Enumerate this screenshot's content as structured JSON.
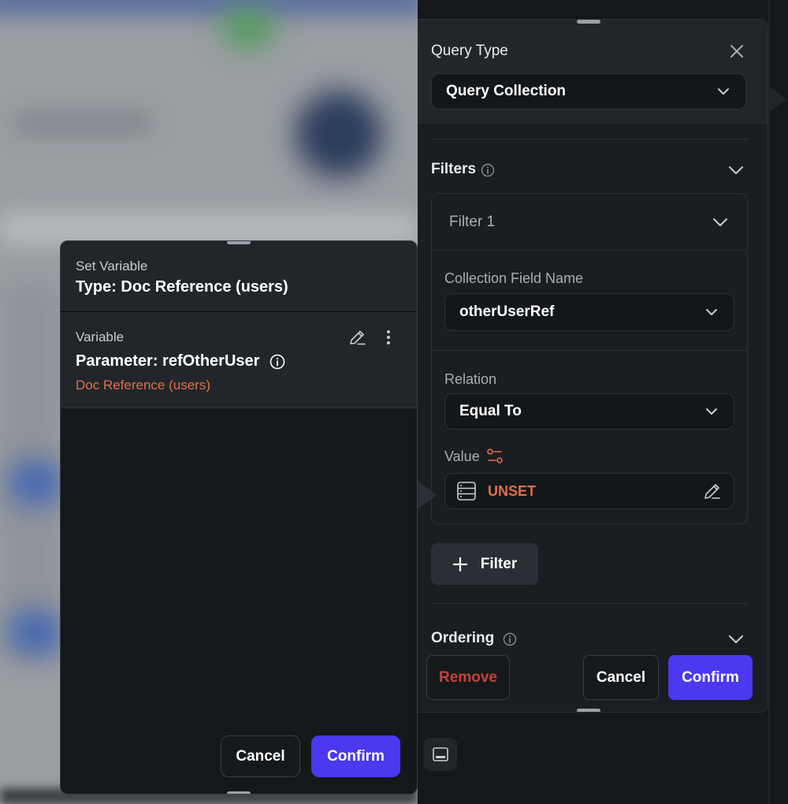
{
  "set_variable": {
    "header_label": "Set Variable",
    "type_label": "Type: Doc Reference (users)",
    "variable_label": "Variable",
    "parameter": "Parameter: refOtherUser",
    "doc_type": "Doc Reference (users)",
    "cancel_label": "Cancel",
    "confirm_label": "Confirm"
  },
  "query": {
    "query_type_label": "Query Type",
    "query_type_value": "Query Collection",
    "filters_label": "Filters",
    "filter_name": "Filter 1",
    "collection_field_label": "Collection Field Name",
    "collection_field_value": "otherUserRef",
    "relation_label": "Relation",
    "relation_value": "Equal To",
    "value_label": "Value",
    "value_status": "UNSET",
    "add_filter_label": "Filter",
    "ordering_label": "Ordering",
    "remove_label": "Remove",
    "cancel_label": "Cancel",
    "confirm_label": "Confirm"
  },
  "colors": {
    "accent": "#4b39ef",
    "warning_orange": "#e2704a",
    "remove_red": "#c8403a",
    "panel_bg": "#1a1d21",
    "surface_bg": "#22262b"
  },
  "icons": [
    "close-icon",
    "chevron-down-icon",
    "info-icon",
    "edit-icon",
    "more-vertical-icon",
    "database-icon",
    "variable-icon",
    "plus-icon",
    "panel-toggle-icon"
  ]
}
